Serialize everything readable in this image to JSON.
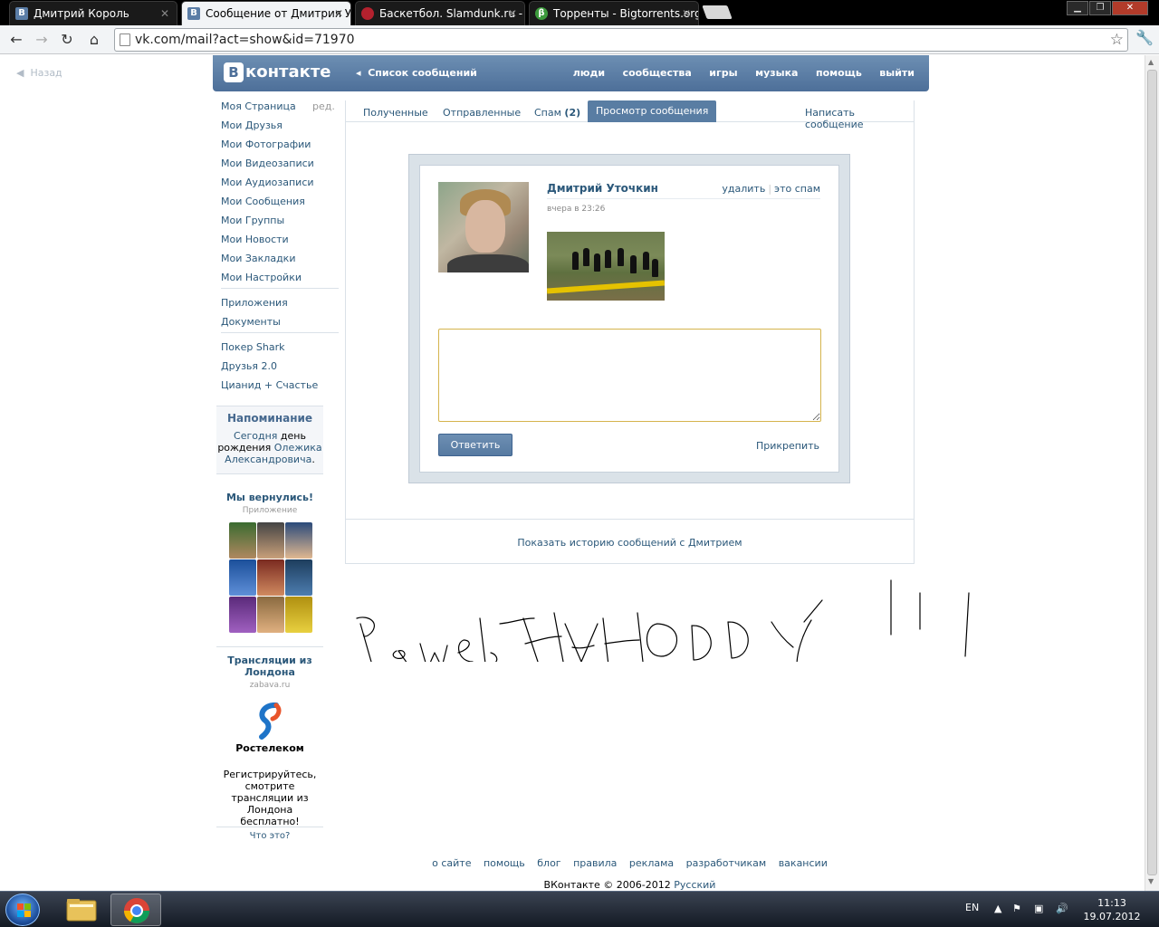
{
  "browser": {
    "tabs": [
      {
        "title": "Дмитрий Король",
        "favicon": "vk-icon"
      },
      {
        "title": "Сообщение от Дмитрия У",
        "favicon": "vk-icon"
      },
      {
        "title": "Баскетбол. Slamdunk.ru -",
        "favicon": "basketball-icon"
      },
      {
        "title": "Торренты - Bigtorrents.org",
        "favicon": "bigtorrents-icon"
      }
    ],
    "active_tab": 1,
    "url": "vk.com/mail?act=show&id=71970"
  },
  "page": {
    "back_label": "Назад",
    "logo_text": "контакте",
    "logo_letter": "В",
    "header_link": "Список сообщений",
    "top_nav": [
      "люди",
      "сообщества",
      "игры",
      "музыка",
      "помощь",
      "выйти"
    ],
    "left_menu": {
      "edit_label": "ред.",
      "group1": [
        "Моя Страница",
        "Мои Друзья",
        "Мои Фотографии",
        "Мои Видеозаписи",
        "Мои Аудиозаписи",
        "Мои Сообщения",
        "Мои Группы",
        "Мои Новости",
        "Мои Закладки",
        "Мои Настройки"
      ],
      "group2": [
        "Приложения",
        "Документы"
      ],
      "group3": [
        "Покер Shark",
        "Друзья 2.0",
        "Цианид + Счастье"
      ]
    },
    "reminder": {
      "title": "Напоминание",
      "today": "Сегодня",
      "text1": " день рождения ",
      "name": "Олежика Александровича",
      "dot": "."
    },
    "ad1": {
      "title": "Мы вернулись!",
      "sub": "Приложение"
    },
    "ad2": {
      "title": "Трансляции из Лондона",
      "sub": "zabava.ru",
      "brand": "Ростелеком",
      "desc": "Регистрируйтесь, смотрите трансляции из Лондона бесплатно!"
    },
    "what_is": "Что это?",
    "mail_tabs": {
      "inbox": "Полученные",
      "sent": "Отправленные",
      "spam": "Спам",
      "spam_count": "(2)",
      "view": "Просмотр сообщения",
      "write": "Написать сообщение"
    },
    "message": {
      "sender": "Дмитрий Уточкин",
      "delete": "удалить",
      "spam": "это спам",
      "separator": "|",
      "time": "вчера в 23:26"
    },
    "reply": {
      "button": "Ответить",
      "attach": "Прикрепить",
      "value": ""
    },
    "history_link": "Показать историю сообщений с Дмитрием",
    "footer_links": [
      "о сайте",
      "помощь",
      "блог",
      "правила",
      "реклама",
      "разработчикам",
      "вакансии"
    ],
    "copyright": "ВКонтакте © 2006-2012",
    "language": "Русский"
  },
  "taskbar": {
    "lang": "EN",
    "time": "11:13",
    "date": "19.07.2012"
  }
}
